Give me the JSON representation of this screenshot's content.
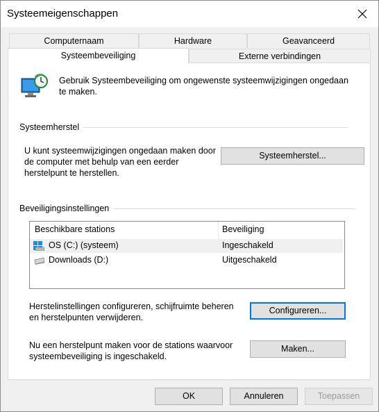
{
  "window": {
    "title": "Systeemeigenschappen"
  },
  "tabs": {
    "row1": [
      "Computernaam",
      "Hardware",
      "Geavanceerd"
    ],
    "row2": [
      "Systeembeveiliging",
      "Externe verbindingen"
    ],
    "active": "Systeembeveiliging"
  },
  "intro": {
    "text": "Gebruik Systeembeveiliging om ongewenste systeemwijzigingen ongedaan te maken."
  },
  "restore": {
    "group_label": "Systeemherstel",
    "description": "U kunt systeemwijzigingen ongedaan maken door de computer met behulp van een eerder herstelpunt te herstellen.",
    "button_label": "Systeemherstel..."
  },
  "protection": {
    "group_label": "Beveiligingsinstellingen",
    "columns": [
      "Beschikbare stations",
      "Beveiliging"
    ],
    "drives": [
      {
        "name": "OS (C:) (systeem)",
        "status": "Ingeschakeld",
        "icon": "system-drive-icon"
      },
      {
        "name": "Downloads (D:)",
        "status": "Uitgeschakeld",
        "icon": "drive-icon"
      }
    ],
    "configure_text": "Herstelinstellingen configureren, schijfruimte beheren en herstelpunten verwijderen.",
    "configure_button": "Configureren...",
    "create_text": "Nu een herstelpunt maken voor de stations waarvoor systeembeveiliging is ingeschakeld.",
    "create_button": "Maken..."
  },
  "footer": {
    "ok": "OK",
    "cancel": "Annuleren",
    "apply": "Toepassen"
  },
  "colors": {
    "focus": "#0078d7",
    "panel": "#ffffff",
    "dialog": "#f0f0f0"
  }
}
